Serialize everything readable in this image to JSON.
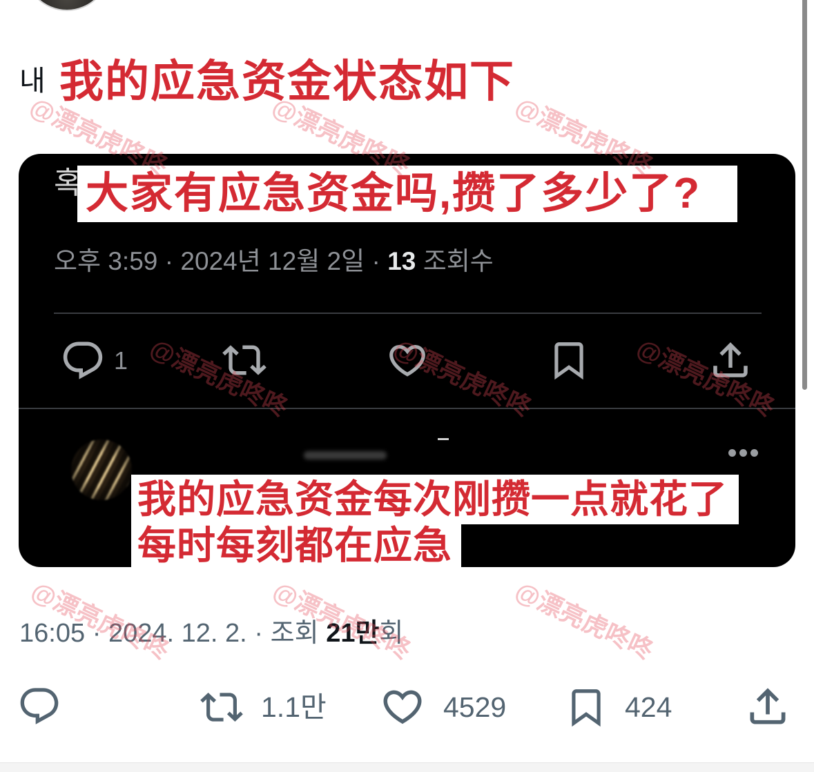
{
  "post": {
    "author_avatar_icon": "user-avatar",
    "text_prefix": "내",
    "caption": "我的应急资金状态如下"
  },
  "attached_image": {
    "partial_heading": "혹",
    "caption": "大家有应急资金吗,攒了多少了?",
    "meta": {
      "time": "오후 3:59",
      "separator": "·",
      "date": "2024년 12월 2일",
      "views_count": "13",
      "views_label": "조회수"
    },
    "actions": {
      "reply_icon": "reply-icon",
      "reply_count": "1",
      "retweet_icon": "retweet-icon",
      "like_icon": "heart-icon",
      "bookmark_icon": "bookmark-icon",
      "share_icon": "share-icon"
    },
    "reply": {
      "avatar_icon": "user-avatar",
      "more_icon": "more-options-icon",
      "caption_line1": "我的应急资金每次刚攒一点就花了",
      "caption_line2": "每时每刻都在应急"
    }
  },
  "meta": {
    "time": "16:05",
    "separator": "·",
    "date": "2024. 12. 2.",
    "views_prefix": "조회",
    "views_count": "21만",
    "views_suffix": "회"
  },
  "actions": {
    "reply_icon": "reply-icon",
    "retweet_icon": "retweet-icon",
    "retweet_count": "1.1만",
    "like_icon": "heart-icon",
    "like_count": "4529",
    "bookmark_icon": "bookmark-icon",
    "bookmark_count": "424",
    "share_icon": "share-icon"
  },
  "watermark": {
    "text": "@漂亮虎咚咚"
  },
  "colors": {
    "caption_red": "#d42a33",
    "text_primary": "#0f1419",
    "text_secondary": "#536471",
    "embed_bg": "#000000",
    "embed_text": "#8e9196",
    "embed_icon": "#a7aaae",
    "embed_divider": "#3a3d41",
    "watermark": "rgba(228, 72, 88, 0.34)"
  }
}
